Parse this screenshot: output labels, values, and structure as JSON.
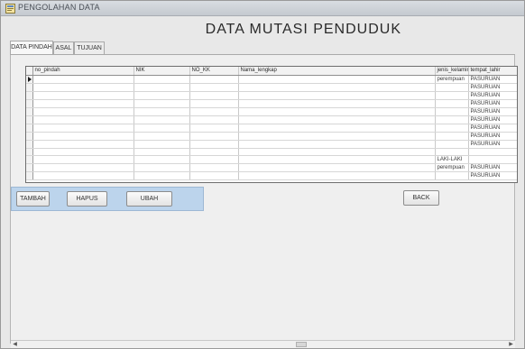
{
  "window": {
    "title": "PENGOLAHAN DATA"
  },
  "heading": "DATA MUTASI PENDUDUK",
  "tabs": [
    {
      "label": "DATA PINDAH",
      "active": true
    },
    {
      "label": "ASAL",
      "active": false
    },
    {
      "label": "TUJUAN",
      "active": false
    }
  ],
  "grid": {
    "columns": [
      "no_pindah",
      "NIK",
      "NO_KK",
      "Nama_lengkap",
      "jenis_kelamin",
      "tempat_lahir"
    ],
    "rows": [
      [
        "",
        "",
        "",
        "",
        "perempuan",
        "PASURUAN"
      ],
      [
        "",
        "",
        "",
        "",
        "",
        "PASURUAN"
      ],
      [
        "",
        "",
        "",
        "",
        "",
        "PASURUAN"
      ],
      [
        "",
        "",
        "",
        "",
        "",
        "PASURUAN"
      ],
      [
        "",
        "",
        "",
        "",
        "",
        "PASURUAN"
      ],
      [
        "",
        "",
        "",
        "",
        "",
        "PASURUAN"
      ],
      [
        "",
        "",
        "",
        "",
        "",
        "PASURUAN"
      ],
      [
        "",
        "",
        "",
        "",
        "",
        "PASURUAN"
      ],
      [
        "",
        "",
        "",
        "",
        "",
        "PASURUAN"
      ],
      [
        "",
        "",
        "",
        "",
        "",
        ""
      ],
      [
        "",
        "",
        "",
        "",
        "LAKI-LAKI",
        ""
      ],
      [
        "",
        "",
        "",
        "",
        "perempuan",
        "PASURUAN"
      ],
      [
        "",
        "",
        "",
        "",
        "",
        "PASURUAN"
      ]
    ]
  },
  "buttons": {
    "tambah": "TAMBAH",
    "hapus": "HAPUS",
    "ubah": "UBAH",
    "back": "BACK"
  },
  "colors": {
    "button_bar": "#bcd4ec",
    "window_bg": "#e8e8e8"
  },
  "icons": {
    "app": "app-window-icon"
  }
}
